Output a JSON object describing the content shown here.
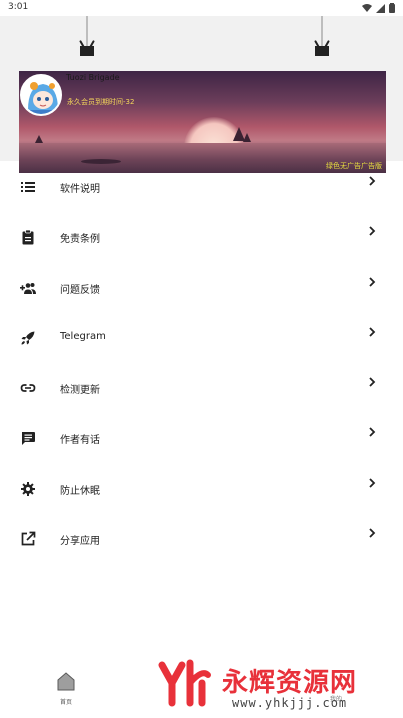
{
  "status_bar": {
    "time": "3:01"
  },
  "banner": {
    "title": "Tuozi Brigade",
    "vip_text": "永久会员到期时间-32",
    "footer_text": "绿色无广告广告版"
  },
  "menu": {
    "items": [
      {
        "label": "软件说明",
        "icon": "list-icon"
      },
      {
        "label": "免责条例",
        "icon": "clipboard-icon"
      },
      {
        "label": "问题反馈",
        "icon": "group-add-icon"
      },
      {
        "label": "Telegram",
        "icon": "rocket-icon"
      },
      {
        "label": "检测更新",
        "icon": "link-icon"
      },
      {
        "label": "作者有话",
        "icon": "message-icon"
      },
      {
        "label": "防止休眠",
        "icon": "gear-icon"
      },
      {
        "label": "分享应用",
        "icon": "open-external-icon"
      }
    ]
  },
  "bottom_nav": {
    "home_label": "首页",
    "other_label": "我的"
  },
  "watermark": {
    "text": "永辉资源网",
    "url": "www.yhkjjj.com"
  },
  "colors": {
    "watermark_red": "#e8313a",
    "banner_gradient_top": "#3e2545",
    "banner_gradient_mid": "#b0586a"
  }
}
